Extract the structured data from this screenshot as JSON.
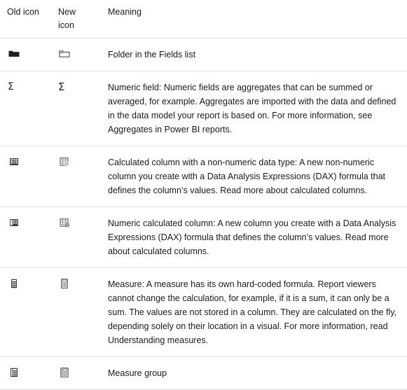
{
  "table": {
    "headers": {
      "old_icon": "Old icon",
      "new_icon": "New icon",
      "meaning": "Meaning"
    },
    "rows": [
      {
        "old_icon_name": "folder-filled-icon",
        "new_icon_name": "folder-outline-icon",
        "meaning": "Folder in the Fields list"
      },
      {
        "old_icon_name": "sigma-icon",
        "new_icon_name": "sigma-icon",
        "old_icon_glyph": "Σ",
        "new_icon_glyph": "Σ",
        "meaning": "Numeric field: Numeric fields are aggregates that can be summed or averaged, for example. Aggregates are imported with the data and defined in the data model your report is based on. For more information, see Aggregates in Power BI reports."
      },
      {
        "old_icon_name": "calculated-column-filled-icon",
        "new_icon_name": "calculated-column-fx-icon",
        "meaning": "Calculated column with a non-numeric data type: A new non-numeric column you create with a Data Analysis Expressions (DAX) formula that defines the column’s values. Read more about calculated columns."
      },
      {
        "old_icon_name": "numeric-calculated-column-filled-icon",
        "new_icon_name": "numeric-calculated-column-icon",
        "meaning": "Numeric calculated column: A new column you create with a Data Analysis Expressions (DAX) formula that defines the column’s values. Read more about calculated columns."
      },
      {
        "old_icon_name": "measure-calculator-filled-icon",
        "new_icon_name": "measure-calculator-icon",
        "meaning": "Measure: A measure has its own hard-coded formula. Report viewers cannot change the calculation, for example, if it is a sum, it can only be a sum. The values are not stored in a column. They are calculated on the fly, depending solely on their location in a visual. For more information, read Understanding measures."
      },
      {
        "old_icon_name": "measure-group-filled-icon",
        "new_icon_name": "measure-group-icon",
        "meaning": "Measure group"
      }
    ]
  },
  "colors": {
    "text": "#1b1a19",
    "icon_dark": "#201f1e",
    "icon_mid": "#605e5c",
    "divider": "#e6e4e2",
    "background": "#ffffff"
  }
}
